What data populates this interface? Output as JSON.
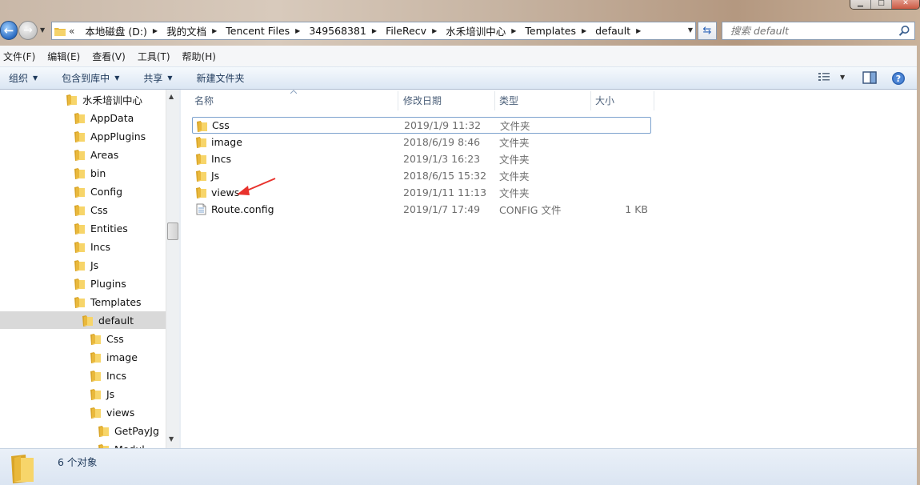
{
  "window": {
    "minimize_glyph": "▁",
    "maximize_glyph": "□",
    "close_glyph": "✕"
  },
  "nav": {
    "back_glyph": "←",
    "forward_glyph": "→"
  },
  "address": {
    "lead": "«",
    "crumbs": [
      "本地磁盘 (D:)",
      "我的文档",
      "Tencent Files",
      "349568381",
      "FileRecv",
      "水禾培训中心",
      "Templates",
      "default"
    ]
  },
  "search": {
    "placeholder": "搜索 default"
  },
  "menu": {
    "items": [
      "文件(F)",
      "编辑(E)",
      "查看(V)",
      "工具(T)",
      "帮助(H)"
    ]
  },
  "toolbar": {
    "organize": "组织",
    "include_library": "包含到库中",
    "share": "共享",
    "new_folder": "新建文件夹"
  },
  "tree": {
    "items": [
      {
        "label": "水禾培训中心",
        "level": 0
      },
      {
        "label": "AppData",
        "level": 1
      },
      {
        "label": "AppPlugins",
        "level": 1
      },
      {
        "label": "Areas",
        "level": 1
      },
      {
        "label": "bin",
        "level": 1
      },
      {
        "label": "Config",
        "level": 1
      },
      {
        "label": "Css",
        "level": 1
      },
      {
        "label": "Entities",
        "level": 1
      },
      {
        "label": "Incs",
        "level": 1
      },
      {
        "label": "Js",
        "level": 1
      },
      {
        "label": "Plugins",
        "level": 1
      },
      {
        "label": "Templates",
        "level": 1
      },
      {
        "label": "default",
        "level": 2,
        "selected": true
      },
      {
        "label": "Css",
        "level": 3
      },
      {
        "label": "image",
        "level": 3
      },
      {
        "label": "Incs",
        "level": 3
      },
      {
        "label": "Js",
        "level": 3
      },
      {
        "label": "views",
        "level": 3
      },
      {
        "label": "GetPayJg",
        "level": 4
      },
      {
        "label": "Modul",
        "level": 4
      }
    ]
  },
  "columns": {
    "name": "名称",
    "modified": "修改日期",
    "type": "类型",
    "size": "大小"
  },
  "files": [
    {
      "name": "Css",
      "modified": "2019/1/9 11:32",
      "type": "文件夹",
      "size": "",
      "kind": "folder"
    },
    {
      "name": "image",
      "modified": "2018/6/19 8:46",
      "type": "文件夹",
      "size": "",
      "kind": "folder"
    },
    {
      "name": "Incs",
      "modified": "2019/1/3 16:23",
      "type": "文件夹",
      "size": "",
      "kind": "folder"
    },
    {
      "name": "Js",
      "modified": "2018/6/15 15:32",
      "type": "文件夹",
      "size": "",
      "kind": "folder"
    },
    {
      "name": "views",
      "modified": "2019/1/11 11:13",
      "type": "文件夹",
      "size": "",
      "kind": "folder"
    },
    {
      "name": "Route.config",
      "modified": "2019/1/7 17:49",
      "type": "CONFIG 文件",
      "size": "1 KB",
      "kind": "file"
    }
  ],
  "status": {
    "count": "6 个对象"
  },
  "colors": {
    "annotation_arrow": "#e8322c",
    "folder": "#e8b93c",
    "accent": "#1e395b"
  }
}
